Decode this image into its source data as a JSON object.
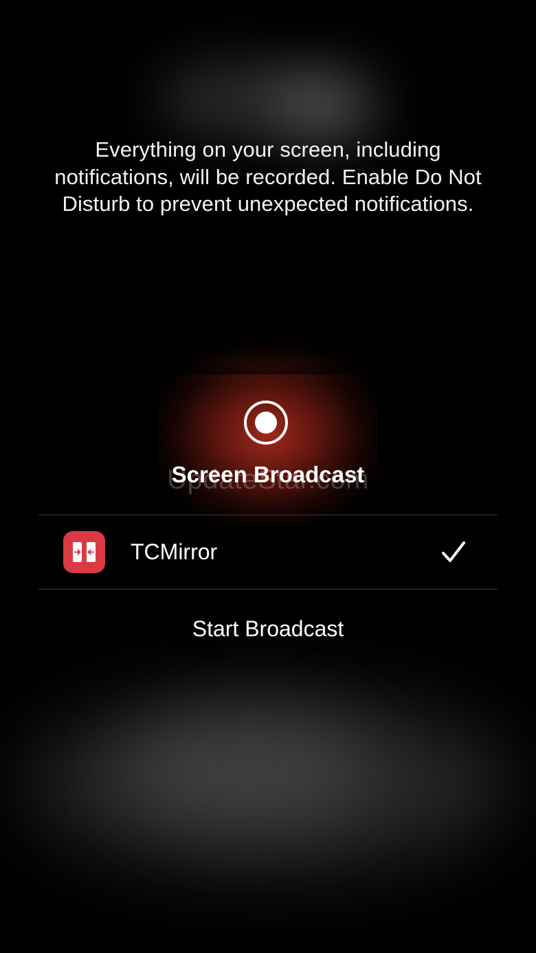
{
  "message": "Everything on your screen, including notifications, will be recorded. Enable Do Not Disturb to prevent unexpected notifications.",
  "panel": {
    "title": "Screen Broadcast",
    "watermark": "UpdateStar.com",
    "record_icon": "record-icon",
    "accent_color": "#a82c1e"
  },
  "apps": [
    {
      "name": "TCMirror",
      "icon": "tcmirror-app-icon",
      "icon_color": "#d93a44",
      "selected": true,
      "selected_icon": "checkmark-icon"
    }
  ],
  "actions": {
    "start_label": "Start Broadcast"
  }
}
